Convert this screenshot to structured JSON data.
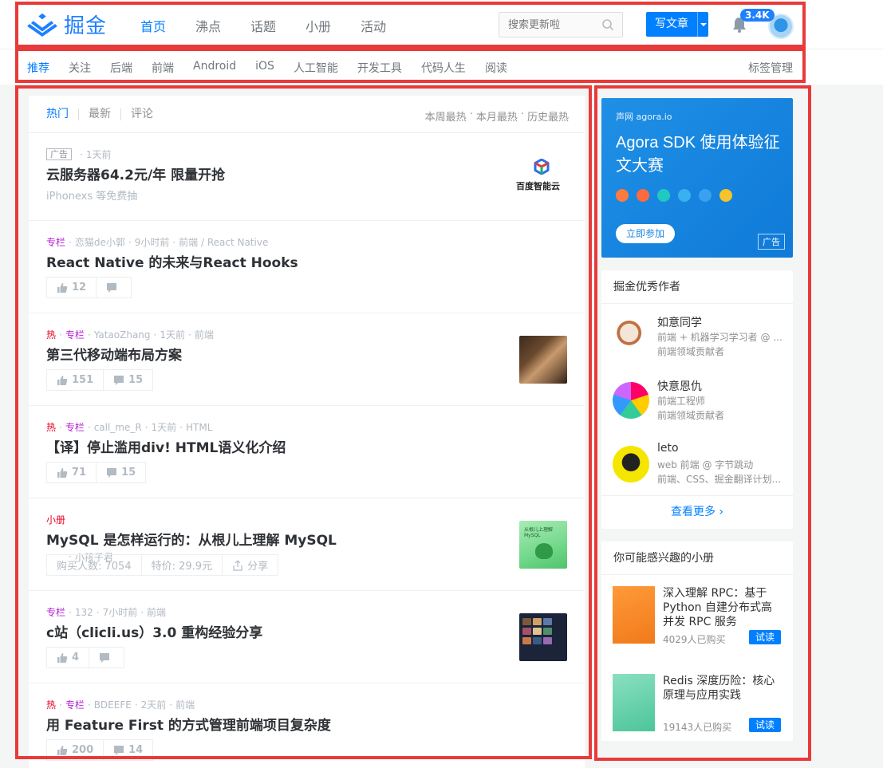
{
  "header": {
    "logo_text": "掘金",
    "nav": [
      "首页",
      "沸点",
      "话题",
      "小册",
      "活动"
    ],
    "search_placeholder": "搜索更新啦",
    "write_label": "写文章",
    "notification_count": "3.4K"
  },
  "subnav": {
    "tags": [
      "推荐",
      "关注",
      "后端",
      "前端",
      "Android",
      "iOS",
      "人工智能",
      "开发工具",
      "代码人生",
      "阅读"
    ],
    "manage": "标签管理"
  },
  "feed": {
    "tabs": [
      "热门",
      "最新",
      "评论"
    ],
    "sort": [
      "本周最热",
      "本月最热",
      "历史最热"
    ],
    "entries": [
      {
        "ad": "广告",
        "time": "1天前",
        "title": "云服务器64.2元/年 限量开抢",
        "sub": "iPhonexs 等免费抽",
        "brand": "百度智能云"
      },
      {
        "col": "专栏",
        "author": "恋猫de小郭",
        "time": "9小时前",
        "tags": "前端 / React Native",
        "title": "React Native 的未来与React Hooks",
        "likes": "12",
        "comments": ""
      },
      {
        "hot": "热",
        "col": "专栏",
        "author": "YataoZhang",
        "time": "1天前",
        "tags": "前端",
        "title": "第三代移动端布局方案",
        "likes": "151",
        "comments": "15"
      },
      {
        "hot": "热",
        "col": "专栏",
        "author": "call_me_R",
        "time": "1天前",
        "tags": "HTML",
        "title": "【译】停止滥用div! HTML语义化介绍",
        "likes": "71",
        "comments": "15"
      },
      {
        "book": "小册",
        "author": "小孩子君",
        "title": "MySQL 是怎样运行的：从根儿上理解 MySQL",
        "buyers": "购买人数: 7054",
        "price": "特价: 29.9元",
        "share": "分享",
        "thumb_text": "从根儿上理解 MySQL"
      },
      {
        "col": "专栏",
        "author": "132",
        "time": "7小时前",
        "tags": "前端",
        "title": "c站（clicli.us）3.0 重构经验分享",
        "likes": "4",
        "comments": ""
      },
      {
        "hot": "热",
        "col": "专栏",
        "author": "BDEEFE",
        "time": "2天前",
        "tags": "前端",
        "title": "用 Feature First 的方式管理前端项目复杂度",
        "likes": "200",
        "comments": "14"
      }
    ]
  },
  "sidebar": {
    "ad": {
      "brand": "声网 agora.io",
      "title": "Agora SDK 使用体验征文大赛",
      "join": "立即参加",
      "label": "广告"
    },
    "authors_title": "掘金优秀作者",
    "authors": [
      {
        "name": "如意同学",
        "desc": "前端 + 机器学习学习者 @ ...",
        "desc2": "前端领域贡献者"
      },
      {
        "name": "快意恩仇",
        "desc": "前端工程师",
        "desc2": "前端领域贡献者"
      },
      {
        "name": "leto",
        "desc": "web 前端 @ 字节跳动",
        "desc2": "前端、CSS、掘金翻译计划..."
      }
    ],
    "more": "查看更多",
    "books_title": "你可能感兴趣的小册",
    "books": [
      {
        "title": "深入理解 RPC：基于 Python 自建分布式高并发 RPC 服务",
        "buyers": "4029人已购买",
        "try": "试读"
      },
      {
        "title": "Redis 深度历险：核心原理与应用实践",
        "buyers": "19143人已购买",
        "try": "试读"
      }
    ]
  },
  "colors": {
    "accent": "#007fff",
    "hot": "#e8001c",
    "column": "#b71ed7",
    "frame": "#e93a3a"
  }
}
